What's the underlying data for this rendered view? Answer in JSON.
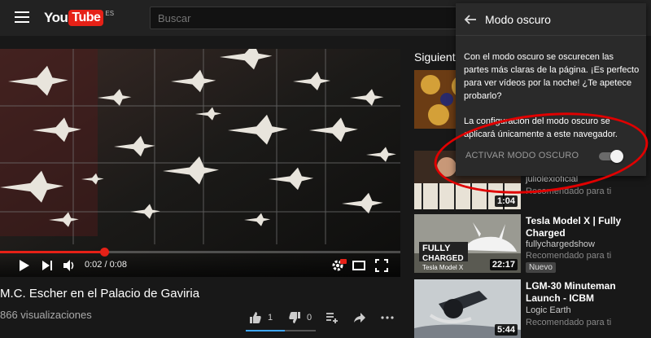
{
  "header": {
    "logo_main": "You",
    "logo_tube": "Tube",
    "logo_region": "ES",
    "search_placeholder": "Buscar"
  },
  "player": {
    "time_current": "0:02",
    "time_total": "0:08",
    "time_display": "0:02 / 0:08",
    "progress": 0.25,
    "accent_color": "#e62117"
  },
  "video": {
    "title": "M.C. Escher en el Palacio de Gaviria",
    "views": "866 visualizaciones",
    "likes": "1",
    "dislikes": "0"
  },
  "sidebar": {
    "heading": "Siguiente",
    "items": [
      {
        "title": "",
        "channel": "",
        "recommended": "",
        "duration": ""
      },
      {
        "title": "",
        "channel": "juliolexioficial",
        "recommended": "Recomendado para ti",
        "duration": "1:04"
      },
      {
        "title": "Tesla Model X | Fully Charged",
        "channel": "fullychargedshow",
        "recommended": "Recomendado para ti",
        "badge": "Nuevo",
        "duration": "22:17",
        "thumb_text_1": "FULLY",
        "thumb_text_2": "CHARGED",
        "thumb_text_3": "Tesla Model X"
      },
      {
        "title": "LGM-30 Minuteman Launch - ICBM",
        "channel": "Logic Earth",
        "recommended": "Recomendado para ti",
        "duration": "5:44"
      }
    ]
  },
  "popup": {
    "title": "Modo oscuro",
    "body1": "Con el modo oscuro se oscurecen las partes más claras de la página. ¡Es perfecto para ver vídeos por la noche! ¿Te apetece probarlo?",
    "body2": "La configuración del modo oscuro se aplicará únicamente a este navegador.",
    "toggle_label": "ACTIVAR MODO OSCURO",
    "toggle_on": true
  },
  "icons": {
    "menu": "hamburger-icon",
    "back": "arrow-left-icon",
    "play": "play-icon",
    "next": "skip-next-icon",
    "volume": "volume-icon",
    "settings": "gear-icon",
    "theater": "theater-mode-icon",
    "fullscreen": "fullscreen-icon",
    "like": "thumbs-up-icon",
    "dislike": "thumbs-down-icon",
    "add": "add-to-playlist-icon",
    "share": "share-icon",
    "more": "more-icon"
  }
}
